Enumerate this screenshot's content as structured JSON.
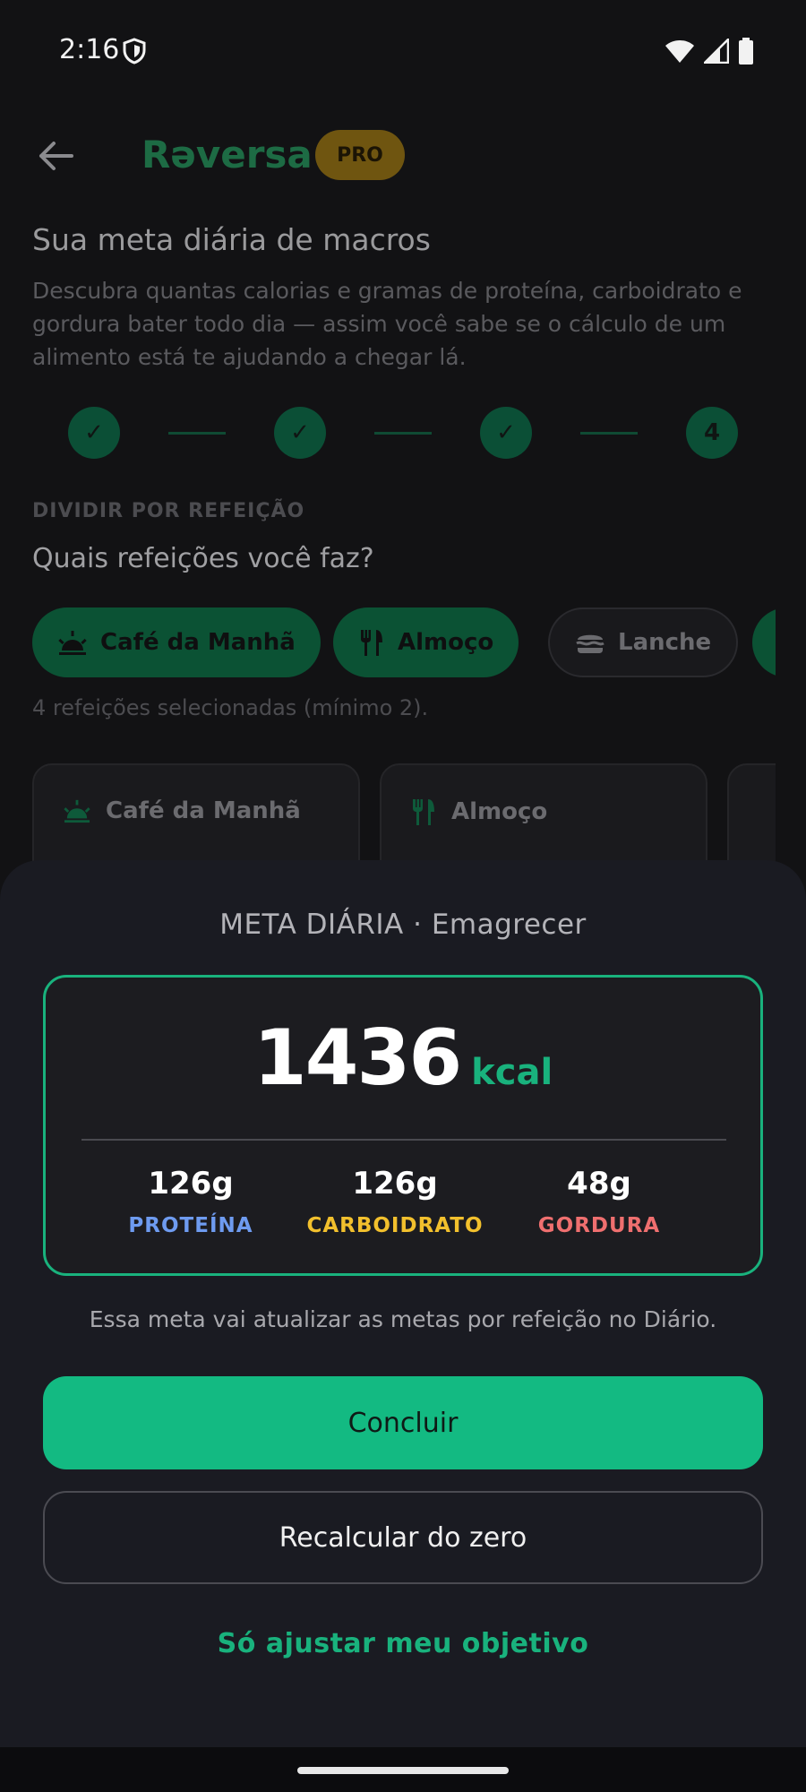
{
  "status_bar": {
    "time": "2:16"
  },
  "header": {
    "brand": "Rəversa",
    "badge": "PRO"
  },
  "intro": {
    "title": "Sua meta diária de macros",
    "description": "Descubra quantas calorias e gramas de proteína, carboidrato e gordura bater todo dia — assim você sabe se o cálculo de um alimento está te ajudando a chegar lá."
  },
  "stepper": {
    "steps": [
      "✓",
      "✓",
      "✓",
      "4"
    ],
    "current_step": 4
  },
  "meals": {
    "section_label": "DIVIDIR POR REFEIÇÃO",
    "question": "Quais refeições você faz?",
    "chips": [
      {
        "label": "Café da Manhã",
        "icon": "sunrise-icon",
        "selected": true
      },
      {
        "label": "Almoço",
        "icon": "fork-knife-icon",
        "selected": true
      },
      {
        "label": "Lanche",
        "icon": "burger-icon",
        "selected": false
      }
    ],
    "selected_note": "4 refeições selecionadas (mínimo 2).",
    "cards": [
      {
        "label": "Café da Manhã",
        "icon": "sunrise-icon"
      },
      {
        "label": "Almoço",
        "icon": "fork-knife-icon"
      }
    ]
  },
  "sheet": {
    "title": "META DIÁRIA · Emagrecer",
    "kcal_value": "1436",
    "kcal_unit": "kcal",
    "macros": [
      {
        "value": "126g",
        "label": "PROTEÍNA",
        "color": "#6e9bf0"
      },
      {
        "value": "126g",
        "label": "CARBOIDRATO",
        "color": "#f2c02d"
      },
      {
        "value": "48g",
        "label": "GORDURA",
        "color": "#ef6f6f"
      }
    ],
    "note": "Essa meta vai atualizar as metas por refeição no Diário.",
    "primary_button": "Concluir",
    "secondary_button": "Recalcular do zero",
    "link_button": "Só ajustar meu objetivo"
  },
  "colors": {
    "accent": "#19b27d",
    "primary_button": "#13ba82",
    "sheet_bg": "#1a1b22"
  }
}
